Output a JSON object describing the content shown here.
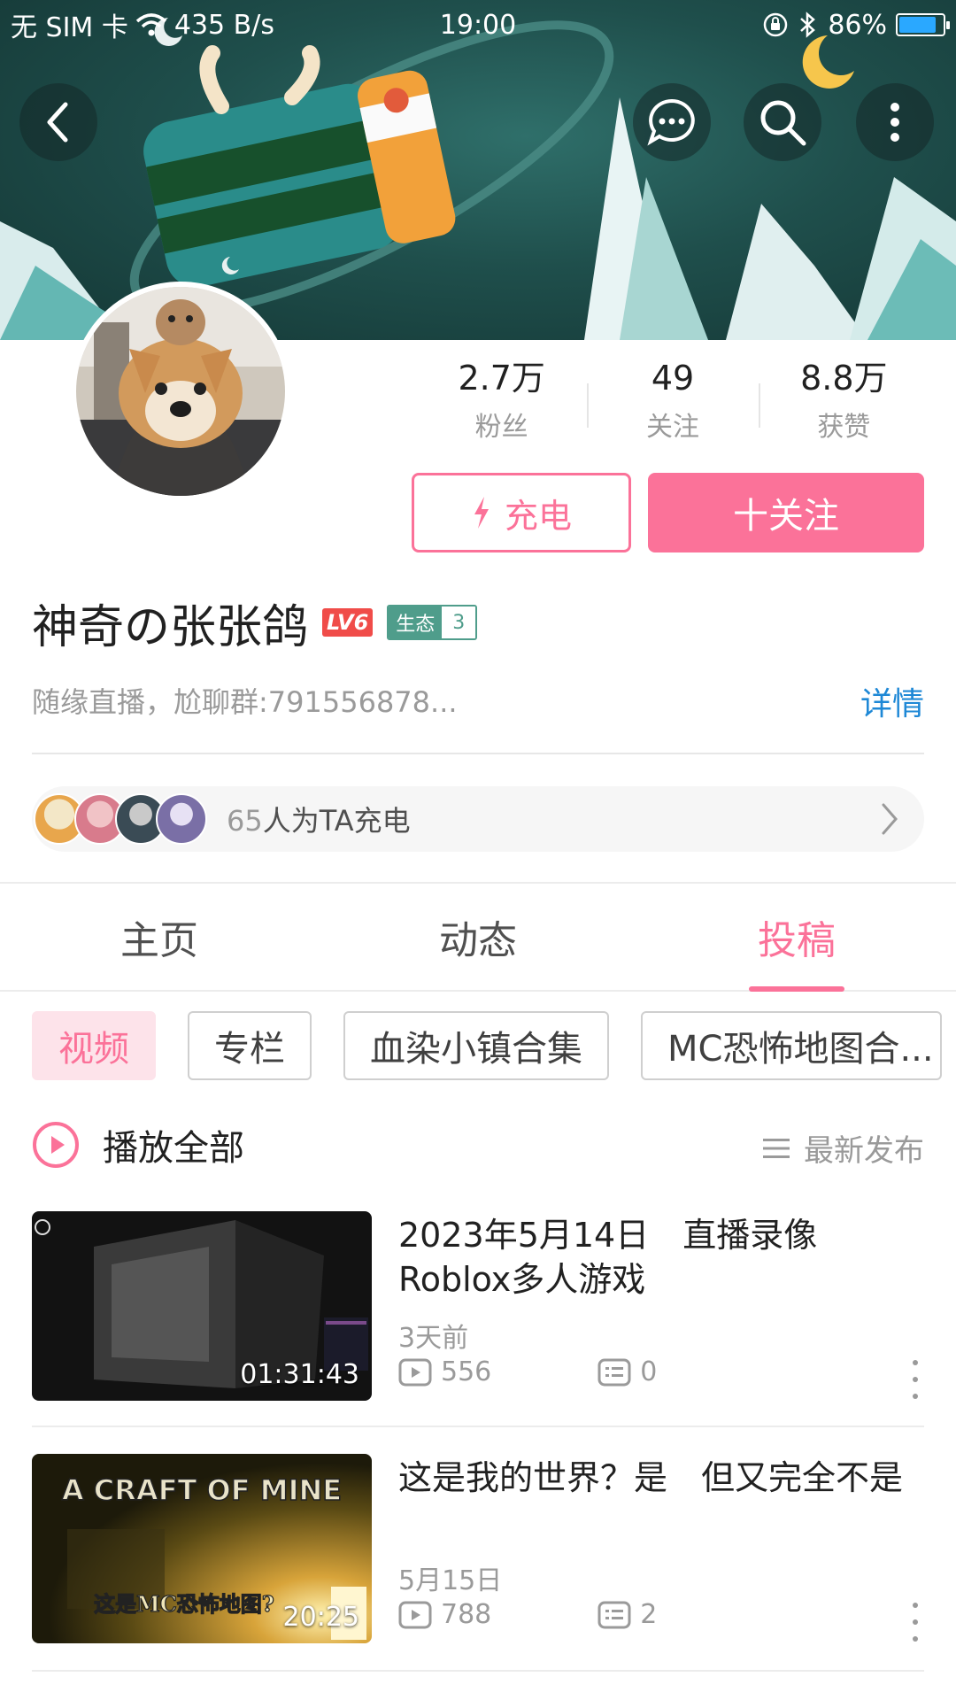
{
  "status_bar": {
    "carrier": "无 SIM 卡",
    "speed": "435 B/s",
    "time": "19:00",
    "battery": "86%",
    "battery_level": 0.86
  },
  "profile": {
    "username": "神奇の张张鸽",
    "level": "LV6",
    "eco_label": "生态",
    "eco_value": "3",
    "bio": "随缘直播，尬聊群:791556878...",
    "detail_link": "详情"
  },
  "stats": [
    {
      "value": "2.7万",
      "label": "粉丝"
    },
    {
      "value": "49",
      "label": "关注"
    },
    {
      "value": "8.8万",
      "label": "获赞"
    }
  ],
  "actions": {
    "charge": "充电",
    "follow": "十关注"
  },
  "charge_row": {
    "count": "65",
    "text": "人为TA充电"
  },
  "tabs": [
    {
      "label": "主页",
      "active": false
    },
    {
      "label": "动态",
      "active": false
    },
    {
      "label": "投稿",
      "active": true
    }
  ],
  "chips": [
    {
      "label": "视频",
      "active": true
    },
    {
      "label": "专栏",
      "active": false
    },
    {
      "label": "血染小镇合集",
      "active": false
    },
    {
      "label": "MC恐怖地图合...",
      "active": false
    }
  ],
  "play_all": {
    "label": "播放全部",
    "sort": "最新发布"
  },
  "videos": [
    {
      "title": "2023年5月14日　直播录像 Roblox多人游戏",
      "date": "3天前",
      "views": "556",
      "comments": "0",
      "duration": "01:31:43"
    },
    {
      "title": "这是我的世界？是　但又完全不是",
      "date": "5月15日",
      "views": "788",
      "comments": "2",
      "duration": "20:25",
      "thumb_text": "A CRAFT OF MINE",
      "thumb_caption": "这是MC恐怖地图?"
    }
  ],
  "colors": {
    "accent": "#fb7299",
    "link": "#1e88d6",
    "eco": "#4f9d8b",
    "level": "#f04c49"
  }
}
